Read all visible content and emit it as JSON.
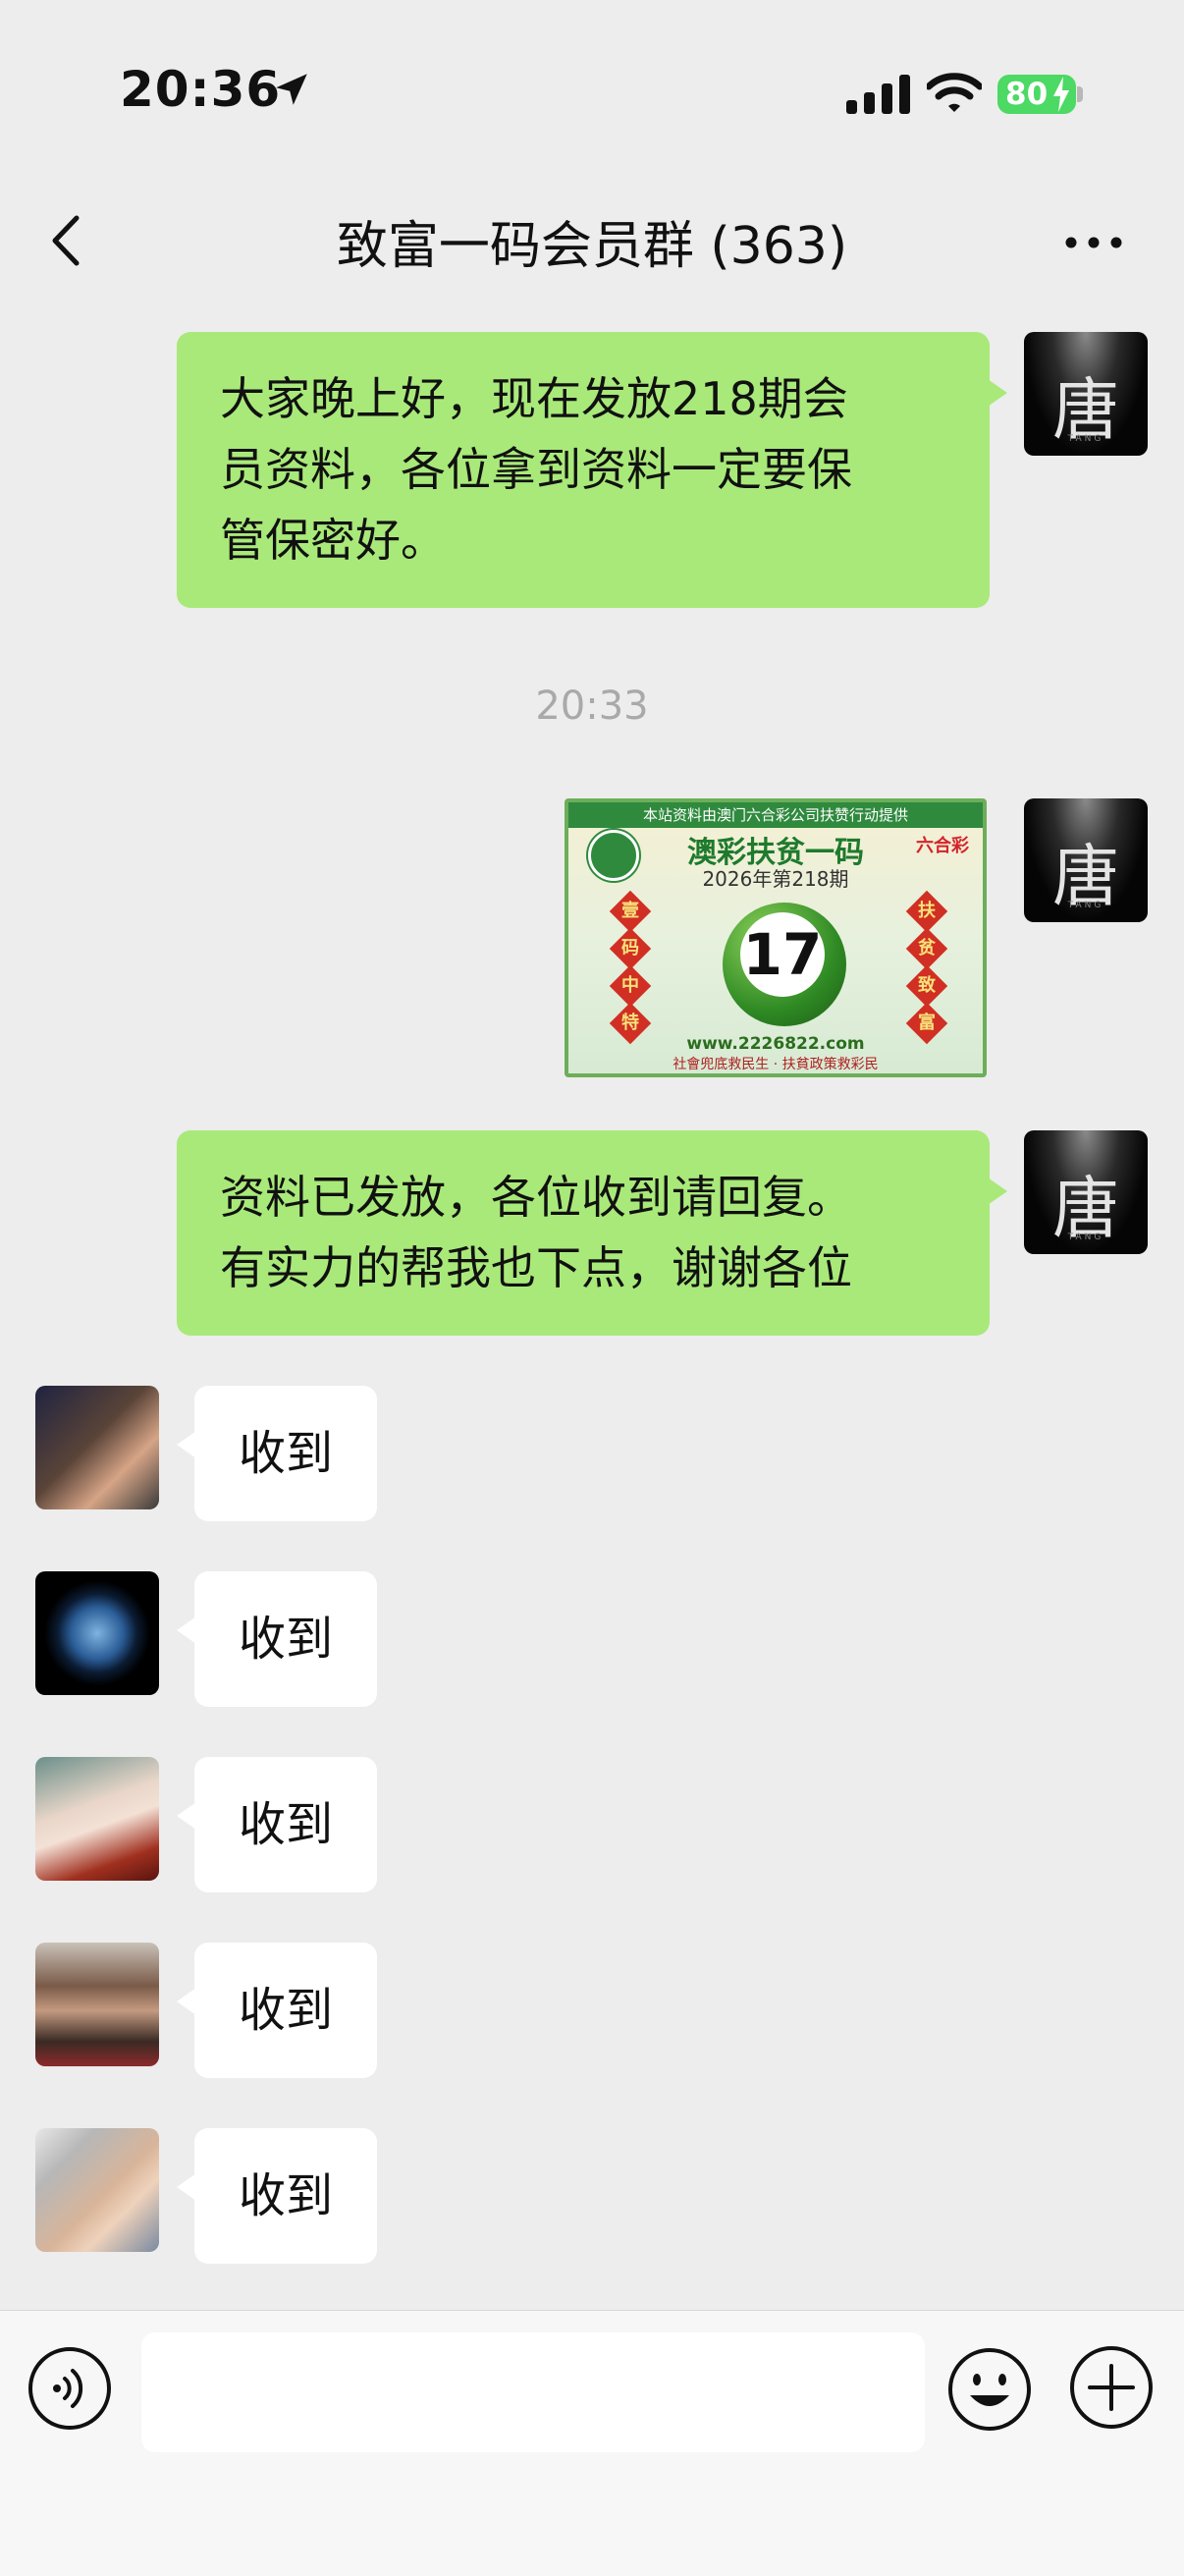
{
  "status": {
    "time": "20:36",
    "battery": "80"
  },
  "header": {
    "title": "致富一码会员群 (363)"
  },
  "messages": {
    "m1": {
      "lines": [
        "大家晚上好，现在发放218期会",
        "员资料，各位拿到资料一定要保",
        "管保密好。"
      ]
    },
    "timestamp": "20:33",
    "poster": {
      "top_text": "本站资料由澳门六合彩公司扶赞行动提供",
      "title": "澳彩扶贫一码",
      "period": "2026年第218期",
      "brand": "六合彩",
      "number": "17",
      "left_chars": [
        "壹",
        "码",
        "中",
        "特"
      ],
      "right_chars": [
        "扶",
        "贫",
        "致",
        "富"
      ],
      "url": "www.2226822.com",
      "slogan": "社會兜底救民生 · 扶貧政策救彩民"
    },
    "m2": {
      "lines": [
        "资料已发放，各位收到请回复。",
        "有实力的帮我也下点，谢谢各位"
      ]
    },
    "avatar_text": "唐",
    "avatar_sub": "TANG",
    "replies": [
      "收到",
      "收到",
      "收到",
      "收到",
      "收到"
    ]
  },
  "input": {
    "value": ""
  }
}
